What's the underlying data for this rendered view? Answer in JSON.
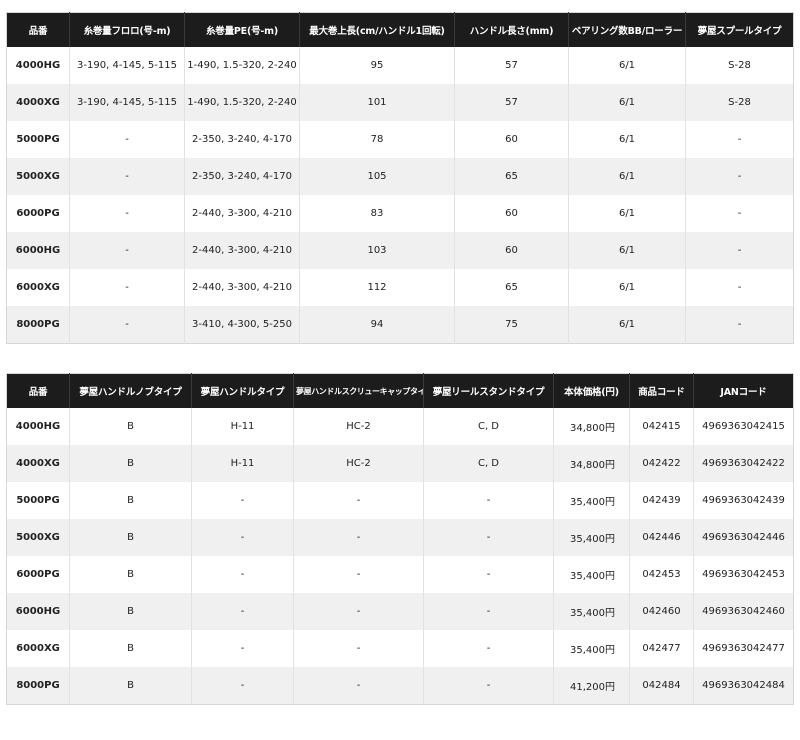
{
  "table1": {
    "headers": [
      "品番",
      "糸巻量フロロ(号-m)",
      "糸巻量PE(号-m)",
      "最大巻上長(cm/ハンドル1回転)",
      "ハンドル長さ(mm)",
      "ベアリング数BB/ローラー",
      "夢屋スプールタイプ"
    ],
    "rows": [
      [
        "4000HG",
        "3-190, 4-145, 5-115",
        "1-490, 1.5-320, 2-240",
        "95",
        "57",
        "6/1",
        "S-28"
      ],
      [
        "4000XG",
        "3-190, 4-145, 5-115",
        "1-490, 1.5-320, 2-240",
        "101",
        "57",
        "6/1",
        "S-28"
      ],
      [
        "5000PG",
        "-",
        "2-350, 3-240, 4-170",
        "78",
        "60",
        "6/1",
        "-"
      ],
      [
        "5000XG",
        "-",
        "2-350, 3-240, 4-170",
        "105",
        "65",
        "6/1",
        "-"
      ],
      [
        "6000PG",
        "-",
        "2-440, 3-300, 4-210",
        "83",
        "60",
        "6/1",
        "-"
      ],
      [
        "6000HG",
        "-",
        "2-440, 3-300, 4-210",
        "103",
        "60",
        "6/1",
        "-"
      ],
      [
        "6000XG",
        "-",
        "2-440, 3-300, 4-210",
        "112",
        "65",
        "6/1",
        "-"
      ],
      [
        "8000PG",
        "-",
        "3-410, 4-300, 5-250",
        "94",
        "75",
        "6/1",
        "-"
      ]
    ]
  },
  "table2": {
    "headers": [
      "品番",
      "夢屋ハンドルノブタイプ",
      "夢屋ハンドルタイプ",
      "夢屋ハンドルスクリューキャップタイプ",
      "夢屋リールスタンドタイプ",
      "本体価格(円)",
      "商品コード",
      "JANコード"
    ],
    "rows": [
      [
        "4000HG",
        "B",
        "H-11",
        "HC-2",
        "C, D",
        "34,800円",
        "042415",
        "4969363042415"
      ],
      [
        "4000XG",
        "B",
        "H-11",
        "HC-2",
        "C, D",
        "34,800円",
        "042422",
        "4969363042422"
      ],
      [
        "5000PG",
        "B",
        "-",
        "-",
        "-",
        "35,400円",
        "042439",
        "4969363042439"
      ],
      [
        "5000XG",
        "B",
        "-",
        "-",
        "-",
        "35,400円",
        "042446",
        "4969363042446"
      ],
      [
        "6000PG",
        "B",
        "-",
        "-",
        "-",
        "35,400円",
        "042453",
        "4969363042453"
      ],
      [
        "6000HG",
        "B",
        "-",
        "-",
        "-",
        "35,400円",
        "042460",
        "4969363042460"
      ],
      [
        "6000XG",
        "B",
        "-",
        "-",
        "-",
        "35,400円",
        "042477",
        "4969363042477"
      ],
      [
        "8000PG",
        "B",
        "-",
        "-",
        "-",
        "41,200円",
        "042484",
        "4969363042484"
      ]
    ]
  }
}
